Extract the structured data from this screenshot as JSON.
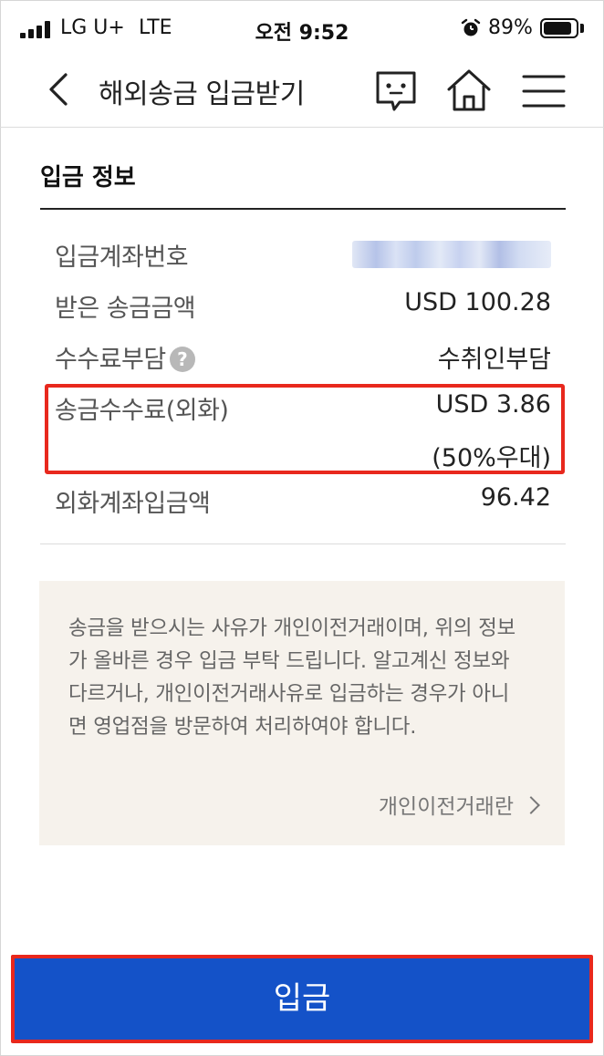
{
  "status_bar": {
    "carrier": "LG U+",
    "network": "LTE",
    "time": "오전 9:52",
    "battery_percent": "89%",
    "battery_level": 0.89
  },
  "header": {
    "title": "해외송금 입금받기",
    "icons": [
      "back-icon",
      "chat-icon",
      "home-icon",
      "menu-icon"
    ]
  },
  "section": {
    "title": "입금 정보"
  },
  "info_rows": {
    "account": {
      "label": "입금계좌번호",
      "value_hidden": true
    },
    "received": {
      "label": "받은 송금금액",
      "value": "USD 100.28"
    },
    "fee_bearer": {
      "label": "수수료부담",
      "value": "수취인부담",
      "help": "?"
    },
    "fee": {
      "label": "송금수수료(외화)",
      "value": "USD 3.86",
      "value_note": "(50%우대)"
    },
    "deposit_amount": {
      "label": "외화계좌입금액",
      "value": "96.42"
    }
  },
  "notice": {
    "text": "송금을 받으시는 사유가 개인이전거래이며, 위의 정보가 올바른 경우 입금 부탁 드립니다. 알고계신 정보와 다르거나, 개인이전거래사유로 입금하는 경우가 아니면 영업점을 방문하여 처리하여야 합니다.",
    "link_label": "개인이전거래란"
  },
  "deposit_button": {
    "label": "입금"
  },
  "colors": {
    "button_bg": "#1452c8",
    "highlight": "#e8281d",
    "notice_bg": "#f6f2ec"
  }
}
